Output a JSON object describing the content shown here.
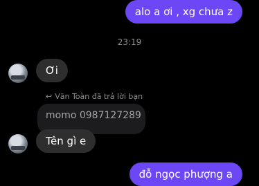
{
  "messages": {
    "out_1": "alo a ơi , xg chưa z",
    "timestamp": "23:19",
    "in_1": "Ơi",
    "reply_meta": "Văn Toàn đã trả lời bạn",
    "quoted_text": "momo 0987127289",
    "in_2": "Tên gì e",
    "out_2": "đỗ ngọc phượng a"
  },
  "colors": {
    "outgoing_bubble": "#6b47f5",
    "incoming_bubble": "#2e2e2e",
    "quoted_bubble": "#1c1c1e",
    "background": "#000000"
  },
  "icons": {
    "reply": "reply-arrow-icon",
    "avatar": "contact-avatar"
  }
}
